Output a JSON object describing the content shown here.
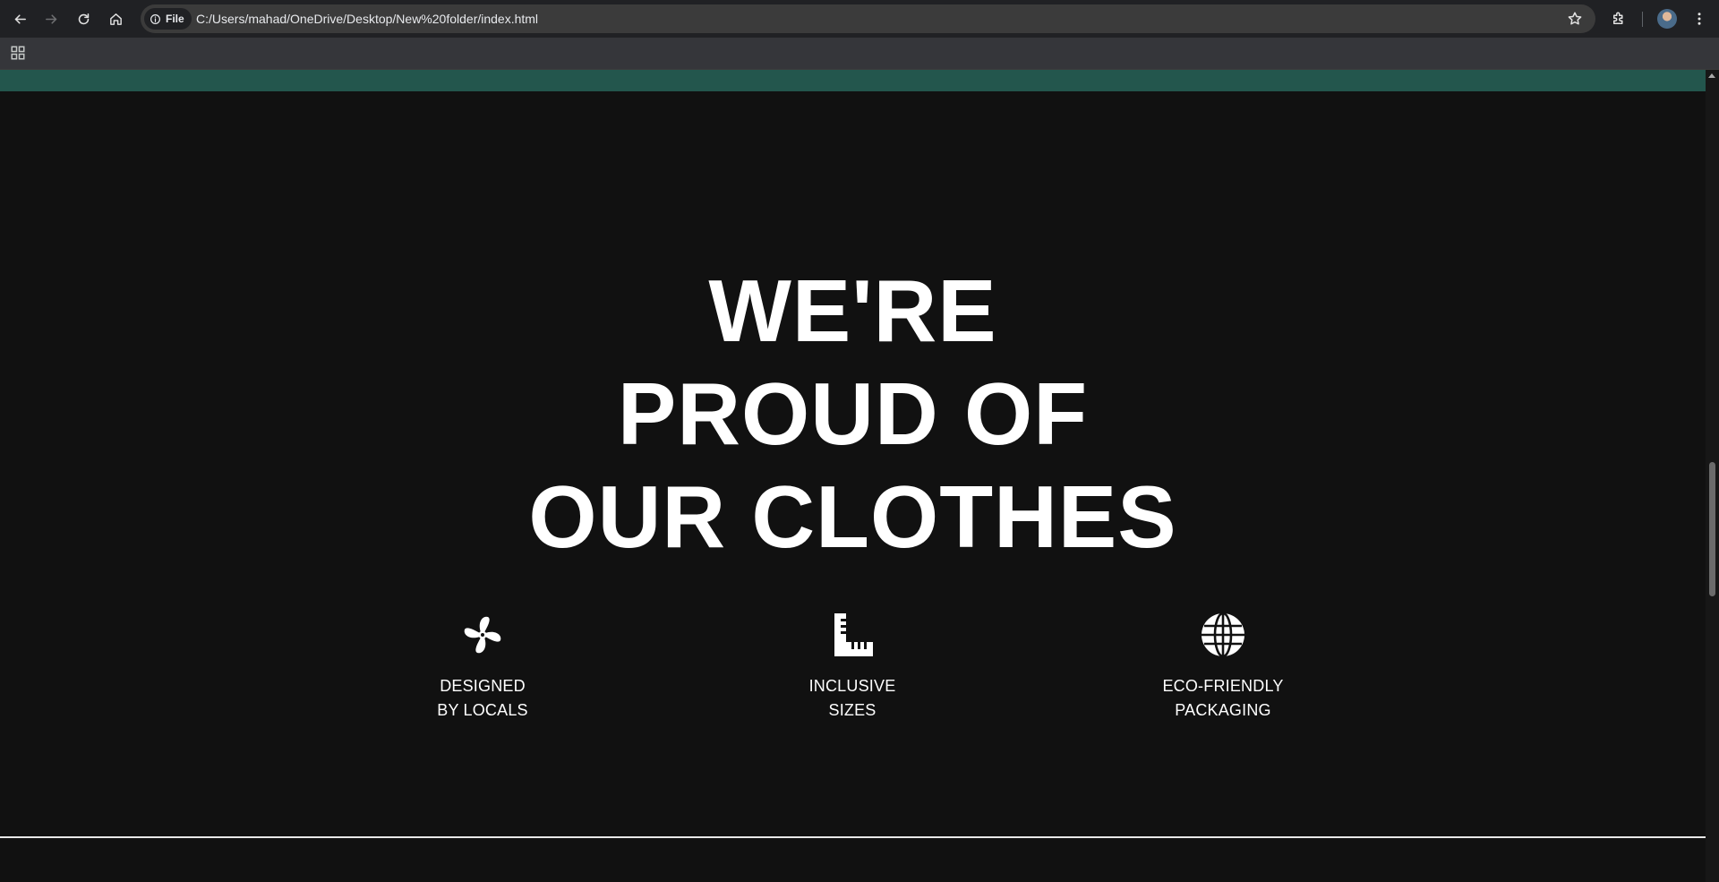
{
  "browser": {
    "site_chip_label": "File",
    "url": "C:/Users/mahad/OneDrive/Desktop/New%20folder/index.html",
    "icons": {
      "back": "arrow-left-icon",
      "forward": "arrow-right-icon",
      "reload": "reload-icon",
      "home": "home-icon",
      "site_info": "info-icon",
      "bookmark": "star-icon",
      "extensions": "puzzle-icon",
      "profile": "avatar",
      "menu": "kebab-menu-icon",
      "apps": "apps-grid-icon"
    }
  },
  "hero": {
    "headline_lines": [
      "WE'RE",
      "PROUD OF",
      "OUR CLOTHES"
    ]
  },
  "features": [
    {
      "icon": "pinwheel-icon",
      "line1": "DESIGNED",
      "line2": "BY LOCALS"
    },
    {
      "icon": "ruler-icon",
      "line1": "INCLUSIVE",
      "line2": "SIZES"
    },
    {
      "icon": "globe-icon",
      "line1": "ECO-FRIENDLY",
      "line2": "PACKAGING"
    }
  ],
  "colors": {
    "page_background": "#111111",
    "teal_strip": "#23564d",
    "text": "#ffffff",
    "browser_chrome": "#202124"
  }
}
